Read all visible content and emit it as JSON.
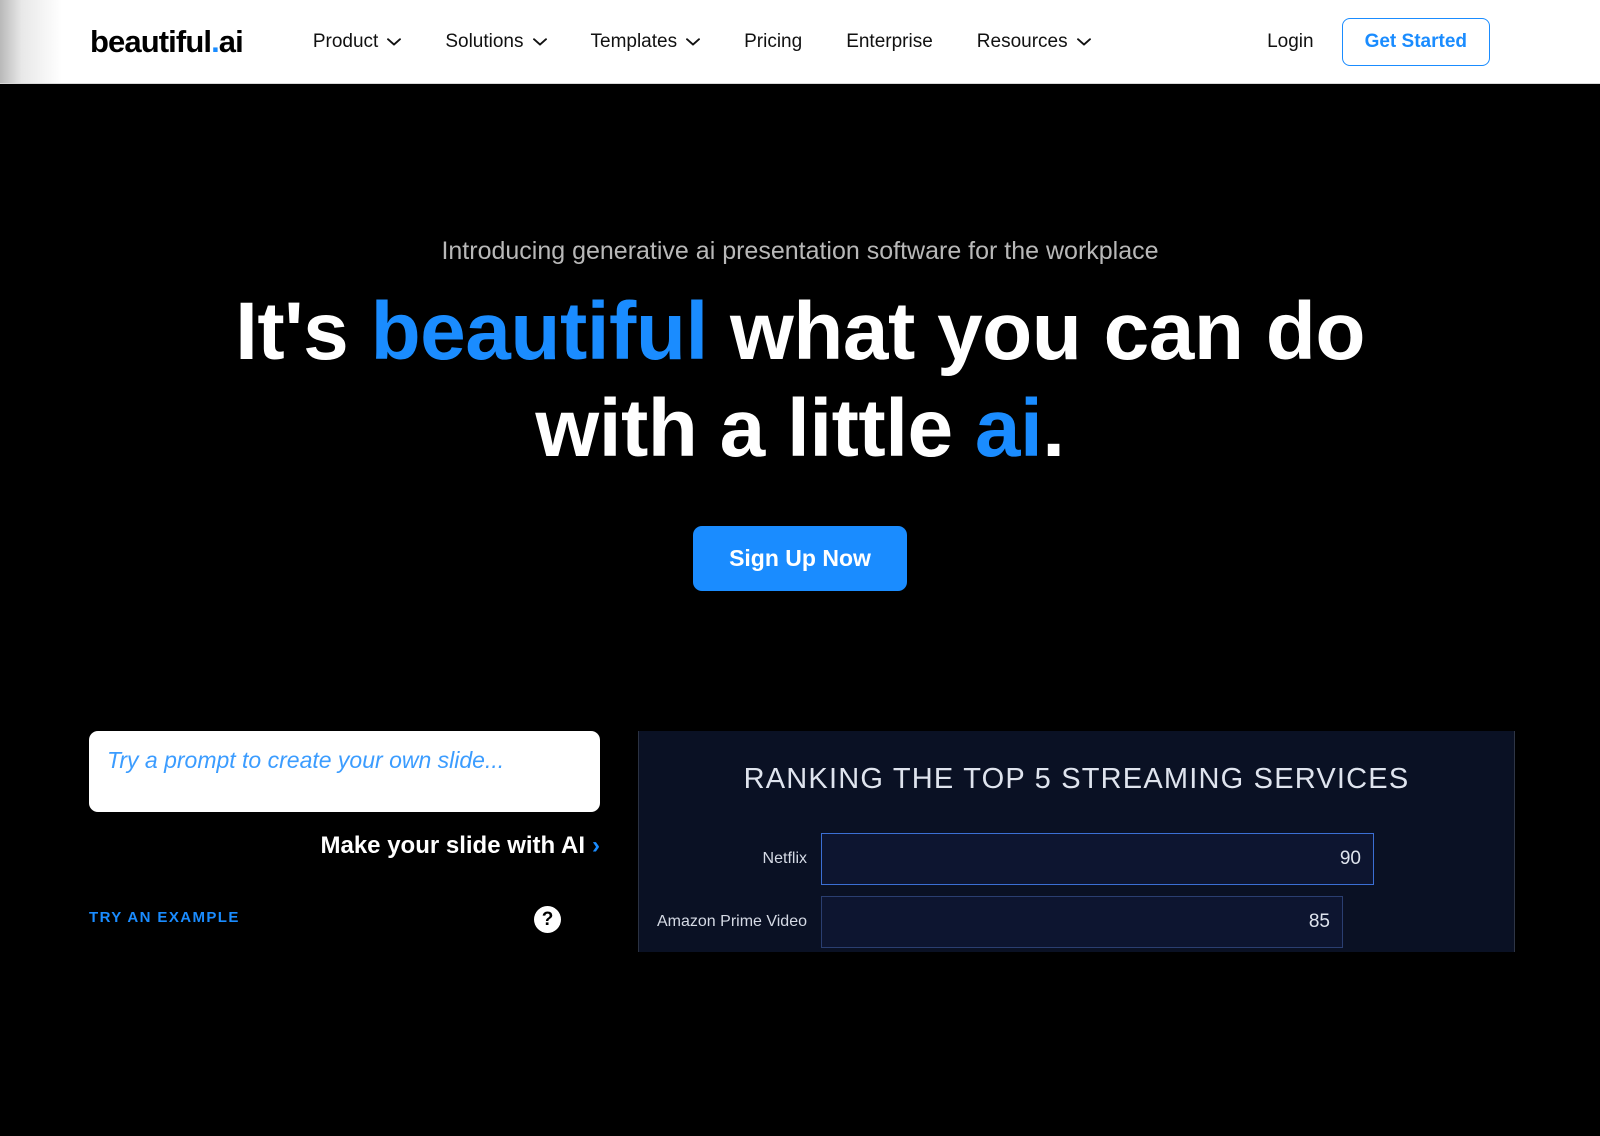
{
  "nav": {
    "logo_text": "beautiful",
    "logo_dot": ".",
    "logo_suffix": "ai",
    "items": [
      {
        "label": "Product",
        "has_chevron": true
      },
      {
        "label": "Solutions",
        "has_chevron": true
      },
      {
        "label": "Templates",
        "has_chevron": true
      },
      {
        "label": "Pricing",
        "has_chevron": false
      },
      {
        "label": "Enterprise",
        "has_chevron": false
      },
      {
        "label": "Resources",
        "has_chevron": true
      }
    ],
    "login_label": "Login",
    "get_started_label": "Get Started"
  },
  "hero": {
    "eyebrow": "Introducing generative ai presentation software for the workplace",
    "headline_part1": "It's ",
    "headline_highlight1": "beautiful",
    "headline_part2": " what you can do",
    "headline_part3": "with a little ",
    "headline_highlight2": "ai",
    "headline_part4": ".",
    "cta_label": "Sign Up Now"
  },
  "prompt": {
    "placeholder": "Try a prompt to create your own slide...",
    "value": "",
    "make_slide_label": "Make your slide with AI",
    "make_slide_arrow": "›",
    "try_example_label": "TRY AN EXAMPLE",
    "help_icon_glyph": "?"
  },
  "slide": {
    "title": "RANKING THE TOP 5 STREAMING SERVICES"
  },
  "colors": {
    "accent_blue": "#1a8cff",
    "page_background": "#000000",
    "nav_background": "#ffffff",
    "slide_background": "#0a1124",
    "bar_border_active": "#3b6fd4",
    "bar_border_dim": "#2a3e70"
  },
  "chart_data": {
    "type": "bar",
    "orientation": "horizontal",
    "title": "RANKING THE TOP 5 STREAMING SERVICES",
    "categories": [
      "Netflix",
      "Amazon Prime Video"
    ],
    "values": [
      90,
      85
    ],
    "xlabel": "",
    "ylabel": "",
    "xlim": [
      0,
      100
    ],
    "grid": false,
    "legend": "none",
    "note": "Slide preview partially cut off at bottom of viewport; only top 2 of 5 bars visible"
  }
}
